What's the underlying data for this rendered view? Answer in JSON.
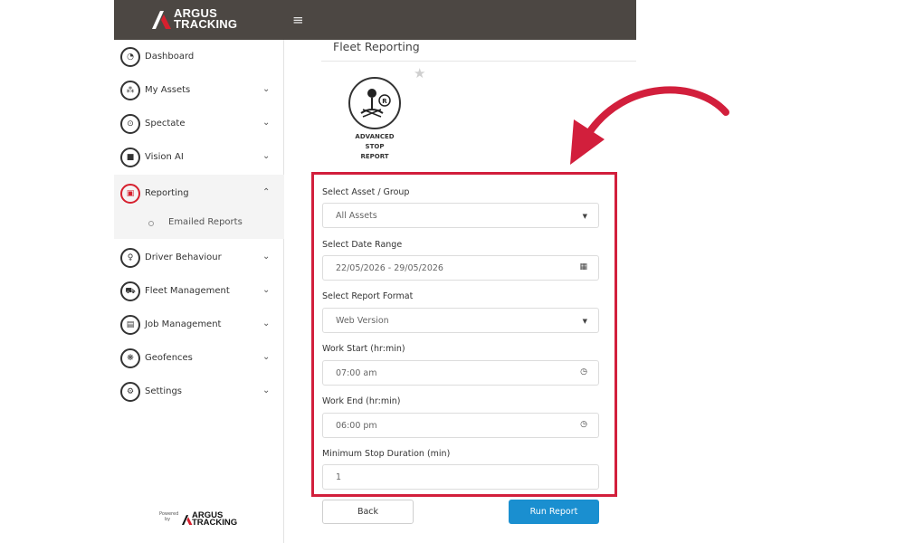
{
  "brand": {
    "line1": "ARGUS",
    "line2": "TRACKING",
    "powered_small_1": "Powered",
    "powered_small_2": "by",
    "powered_brand_1": "ARGUS",
    "powered_brand_2": "TRACKING"
  },
  "header": {
    "menu_icon": "≡"
  },
  "sidebar": {
    "items": [
      {
        "label": "Dashboard",
        "icon": "dashboard-icon",
        "glyph": "◔"
      },
      {
        "label": "My Assets",
        "icon": "assets-icon",
        "glyph": "⁂"
      },
      {
        "label": "Spectate",
        "icon": "location-pin-icon",
        "glyph": "⊙"
      },
      {
        "label": "Vision AI",
        "icon": "camera-icon",
        "glyph": "■"
      },
      {
        "label": "Reporting",
        "icon": "folder-icon",
        "glyph": "▣"
      },
      {
        "label": "Driver Behaviour",
        "icon": "bulb-icon",
        "glyph": "♀"
      },
      {
        "label": "Fleet Management",
        "icon": "car-icon",
        "glyph": "⛟"
      },
      {
        "label": "Job Management",
        "icon": "briefcase-icon",
        "glyph": "▤"
      },
      {
        "label": "Geofences",
        "icon": "geofence-icon",
        "glyph": "❋"
      },
      {
        "label": "Settings",
        "icon": "gear-icon",
        "glyph": "⚙"
      }
    ],
    "sub_item": "Emailed Reports"
  },
  "page_title": "Fleet Reporting",
  "report": {
    "title_1": "ADVANCED",
    "title_2": "STOP",
    "title_3": "REPORT"
  },
  "form": {
    "asset_label": "Select Asset / Group",
    "asset_value": "All Assets",
    "date_label": "Select Date Range",
    "date_value": "22/05/2026 - 29/05/2026",
    "format_label": "Select Report Format",
    "format_value": "Web Version",
    "work_start_label": "Work Start (hr:min)",
    "work_start_value": "07:00 am",
    "work_end_label": "Work End (hr:min)",
    "work_end_value": "06:00 pm",
    "min_stop_label": "Minimum Stop Duration (min)",
    "min_stop_value": "1"
  },
  "buttons": {
    "back": "Back",
    "run": "Run Report"
  },
  "colors": {
    "accent": "#d21f3c",
    "primary": "#1a8fd0",
    "header": "#4c4743"
  }
}
